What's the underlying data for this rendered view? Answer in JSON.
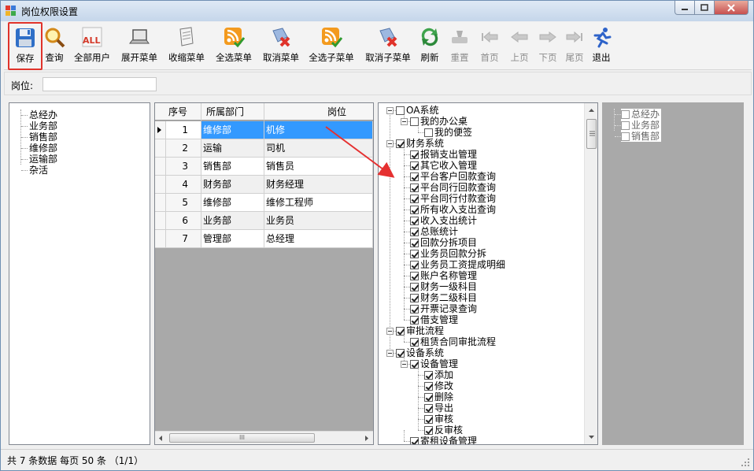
{
  "window": {
    "title": "岗位权限设置"
  },
  "toolbar": {
    "save": "保存",
    "query": "查询",
    "all_users": "全部用户",
    "expand": "展开菜单",
    "collapse": "收缩菜单",
    "select_all": "全选菜单",
    "cancel_menu": "取消菜单",
    "select_sub": "全选子菜单",
    "cancel_sub": "取消子菜单",
    "refresh": "刷新",
    "reset": "重置",
    "first": "首页",
    "prev": "上页",
    "next": "下页",
    "last": "尾页",
    "exit": "退出"
  },
  "position_filter": {
    "label": "岗位:",
    "value": ""
  },
  "departments": [
    "总经办",
    "业务部",
    "销售部",
    "维修部",
    "运输部",
    "杂活"
  ],
  "grid": {
    "headers": {
      "seq": "序号",
      "dept": "所属部门",
      "post": "岗位"
    },
    "rows": [
      {
        "seq": "1",
        "dept": "维修部",
        "post": "机修"
      },
      {
        "seq": "2",
        "dept": "运输",
        "post": "司机"
      },
      {
        "seq": "3",
        "dept": "销售部",
        "post": "销售员"
      },
      {
        "seq": "4",
        "dept": "财务部",
        "post": "财务经理"
      },
      {
        "seq": "5",
        "dept": "维修部",
        "post": "维修工程师"
      },
      {
        "seq": "6",
        "dept": "业务部",
        "post": "业务员"
      },
      {
        "seq": "7",
        "dept": "管理部",
        "post": "总经理"
      }
    ],
    "scroll_glyph": "III"
  },
  "perm_tree": [
    {
      "label": "OA系统",
      "level": 0,
      "checked": false,
      "toggle": true
    },
    {
      "label": "我的办公桌",
      "level": 1,
      "checked": false,
      "toggle": true
    },
    {
      "label": "我的便签",
      "level": 2,
      "checked": false,
      "toggle": false
    },
    {
      "label": "财务系统",
      "level": 0,
      "checked": true,
      "toggle": true
    },
    {
      "label": "报销支出管理",
      "level": 1,
      "checked": true,
      "toggle": false
    },
    {
      "label": "其它收入管理",
      "level": 1,
      "checked": true,
      "toggle": false
    },
    {
      "label": "平台客户回款查询",
      "level": 1,
      "checked": true,
      "toggle": false
    },
    {
      "label": "平台同行回款查询",
      "level": 1,
      "checked": true,
      "toggle": false
    },
    {
      "label": "平台同行付款查询",
      "level": 1,
      "checked": true,
      "toggle": false
    },
    {
      "label": "所有收入支出查询",
      "level": 1,
      "checked": true,
      "toggle": false
    },
    {
      "label": "收入支出统计",
      "level": 1,
      "checked": true,
      "toggle": false
    },
    {
      "label": "总账统计",
      "level": 1,
      "checked": true,
      "toggle": false
    },
    {
      "label": "回款分拆项目",
      "level": 1,
      "checked": true,
      "toggle": false
    },
    {
      "label": "业务员回款分拆",
      "level": 1,
      "checked": true,
      "toggle": false
    },
    {
      "label": "业务员工资提成明细",
      "level": 1,
      "checked": true,
      "toggle": false
    },
    {
      "label": "账户名称管理",
      "level": 1,
      "checked": true,
      "toggle": false
    },
    {
      "label": "财务一级科目",
      "level": 1,
      "checked": true,
      "toggle": false
    },
    {
      "label": "财务二级科目",
      "level": 1,
      "checked": true,
      "toggle": false
    },
    {
      "label": "开票记录查询",
      "level": 1,
      "checked": true,
      "toggle": false
    },
    {
      "label": "借支管理",
      "level": 1,
      "checked": true,
      "toggle": false
    },
    {
      "label": "审批流程",
      "level": 0,
      "checked": true,
      "toggle": true
    },
    {
      "label": "租赁合同审批流程",
      "level": 1,
      "checked": true,
      "toggle": false
    },
    {
      "label": "设备系统",
      "level": 0,
      "checked": true,
      "toggle": true
    },
    {
      "label": "设备管理",
      "level": 1,
      "checked": true,
      "toggle": true
    },
    {
      "label": "添加",
      "level": 2,
      "checked": true,
      "toggle": false
    },
    {
      "label": "修改",
      "level": 2,
      "checked": true,
      "toggle": false
    },
    {
      "label": "删除",
      "level": 2,
      "checked": true,
      "toggle": false
    },
    {
      "label": "导出",
      "level": 2,
      "checked": true,
      "toggle": false
    },
    {
      "label": "审核",
      "level": 2,
      "checked": true,
      "toggle": false
    },
    {
      "label": "反审核",
      "level": 2,
      "checked": true,
      "toggle": false
    },
    {
      "label": "寄租设备管理",
      "level": 1,
      "checked": true,
      "toggle": false
    }
  ],
  "right_tree": [
    "总经办",
    "业务部",
    "销售部"
  ],
  "status": {
    "text": "共 7 条数据  每页 50 条 （1/1）"
  },
  "colors": {
    "selection": "#3399ff",
    "highlight_border": "#e0332b",
    "arrow": "#e53030"
  }
}
